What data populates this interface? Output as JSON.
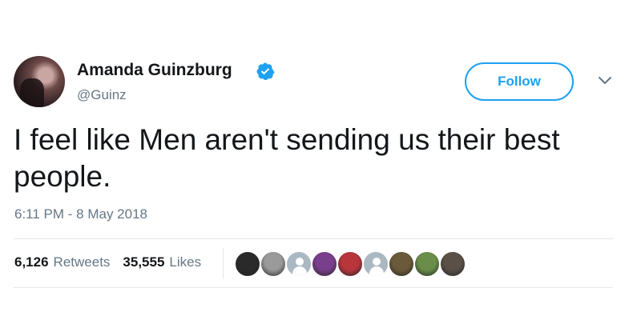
{
  "tweet": {
    "author_name": "Amanda Guinzburg",
    "handle": "@Guinz",
    "follow_label": "Follow",
    "text": "I feel like Men aren't sending us their best people.",
    "timestamp": "6:11 PM - 8 May 2018",
    "retweets_count": "6,126",
    "retweets_label": "Retweets",
    "likes_count": "35,555",
    "likes_label": "Likes"
  },
  "icons": {
    "verified": "verified-badge-icon",
    "menu": "chevron-down-icon"
  },
  "colors": {
    "accent": "#1da1f2",
    "secondary_text": "#657786",
    "primary_text": "#14171a",
    "divider": "#e1e8ed"
  },
  "likers": [
    {
      "style": "photo",
      "color": "#2a2a2a"
    },
    {
      "style": "photo",
      "color": "#9a9a9a"
    },
    {
      "style": "default",
      "color": "#aab8c2"
    },
    {
      "style": "photo",
      "color": "#7a3f8c"
    },
    {
      "style": "photo",
      "color": "#b8353c"
    },
    {
      "style": "default",
      "color": "#aab8c2"
    },
    {
      "style": "photo",
      "color": "#6b5a3a"
    },
    {
      "style": "photo",
      "color": "#6a8e4a"
    },
    {
      "style": "photo",
      "color": "#5a5048"
    }
  ]
}
